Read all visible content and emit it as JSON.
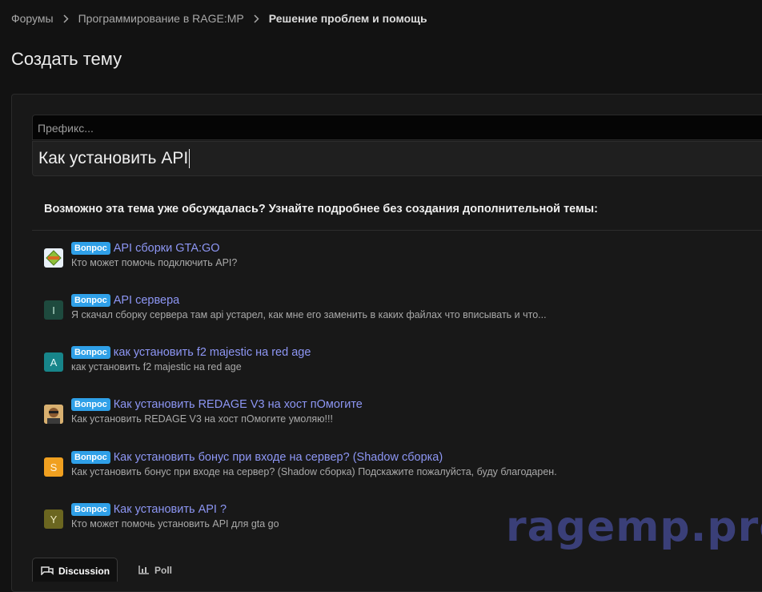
{
  "breadcrumb": [
    {
      "label": "Форумы"
    },
    {
      "label": "Программирование в RAGE:MP"
    },
    {
      "label": "Решение проблем и помощь"
    }
  ],
  "page_title": "Создать тему",
  "form": {
    "prefix_placeholder": "Префикс...",
    "title_value": "Как установить API"
  },
  "similar": {
    "heading": "Возможно эта тема уже обсуждалась? Узнайте подробнее без создания дополнительной темы:",
    "threads": [
      {
        "avatar_letter": "",
        "avatar_color": "#e8f0f8",
        "badge": "Вопрос",
        "title": "API сборки GTA:GO",
        "snippet": "Кто может помочь подключить API?"
      },
      {
        "avatar_letter": "I",
        "avatar_color": "#1e4a3e",
        "badge": "Вопрос",
        "title": "API сервера",
        "snippet": "Я скачал сборку сервера там api устарел, как мне его заменить в каких файлах что вписывать и что..."
      },
      {
        "avatar_letter": "A",
        "avatar_color": "#17858a",
        "badge": "Вопрос",
        "title": "как установить f2 majestic на red age",
        "snippet": "как установить f2 majestic на red age"
      },
      {
        "avatar_letter": "",
        "avatar_color": "#c9a060",
        "badge": "Вопрос",
        "title": "Как установить REDAGE V3 на хост пОмогите",
        "snippet": "Как установить REDAGE V3 на хост пОмогите умоляю!!!"
      },
      {
        "avatar_letter": "S",
        "avatar_color": "#f0a020",
        "badge": "Вопрос",
        "title": "Как установить бонус при входе на сервер? (Shadow сборка)",
        "snippet": "Как установить бонус при входе на сервер? (Shadow сборка) Подскажите пожалуйста, буду благодарен."
      },
      {
        "avatar_letter": "Y",
        "avatar_color": "#6b6620",
        "badge": "Вопрос",
        "title": "Как установить API ?",
        "snippet": "Кто может помочь установить API для gta go"
      }
    ]
  },
  "tabs": [
    {
      "label": "Discussion",
      "icon": "chat-bubbles-icon"
    },
    {
      "label": "Poll",
      "icon": "bar-chart-icon"
    }
  ],
  "watermark": "ragemp.pro"
}
